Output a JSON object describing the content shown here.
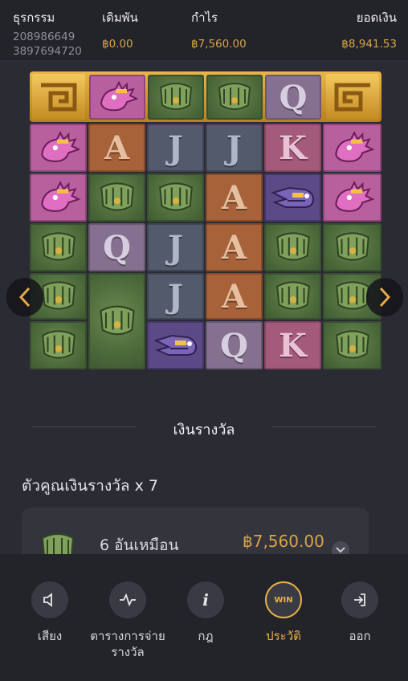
{
  "header": {
    "transaction_label": "ธุรกรรม",
    "transaction_id_1": "208986649",
    "transaction_id_2": "3897694720",
    "bet_label": "เดิมพัน",
    "bet_value": "฿0.00",
    "profit_label": "กำไร",
    "profit_value": "฿7,560.00",
    "balance_label": "ยอดเงิน",
    "balance_value": "฿8,941.53"
  },
  "board": {
    "top_row": [
      "quetzal-pink",
      "totem-green",
      "totem-green",
      "Q"
    ],
    "columns": [
      [
        "quetzal-pink",
        "quetzal-pink",
        "totem-green",
        "totem-green",
        "totem-green"
      ],
      [
        "A",
        "totem-green",
        "Q",
        "totem-green-tall",
        ""
      ],
      [
        "J",
        "totem-green",
        "J",
        "J",
        "serpent-purple"
      ],
      [
        "J",
        "A",
        "A",
        "A",
        "Q"
      ],
      [
        "K",
        "serpent-purple",
        "totem-green",
        "totem-green",
        "K"
      ],
      [
        "quetzal-pink",
        "quetzal-pink",
        "totem-green",
        "totem-green",
        "totem-green"
      ]
    ]
  },
  "prize": {
    "title": "เงินรางวัล",
    "multiplier_text": "ตัวคูณเงินรางวัล x 7",
    "win_quantity": "6 อันเหมือน",
    "win_amount": "฿7,560.00"
  },
  "bottom_nav": [
    {
      "label": "เสียง",
      "icon": "speaker-icon"
    },
    {
      "label": "ตารางการจ่าย\nรางวัล",
      "icon": "paytable-icon"
    },
    {
      "label": "กฎ",
      "icon": "info-icon"
    },
    {
      "label": "ประวัติ",
      "icon": "win-history-icon",
      "icon_text": "WIN"
    },
    {
      "label": "ออก",
      "icon": "exit-icon"
    }
  ],
  "colors": {
    "accent_gold": "#d9a44a",
    "background": "#2b2b33"
  }
}
